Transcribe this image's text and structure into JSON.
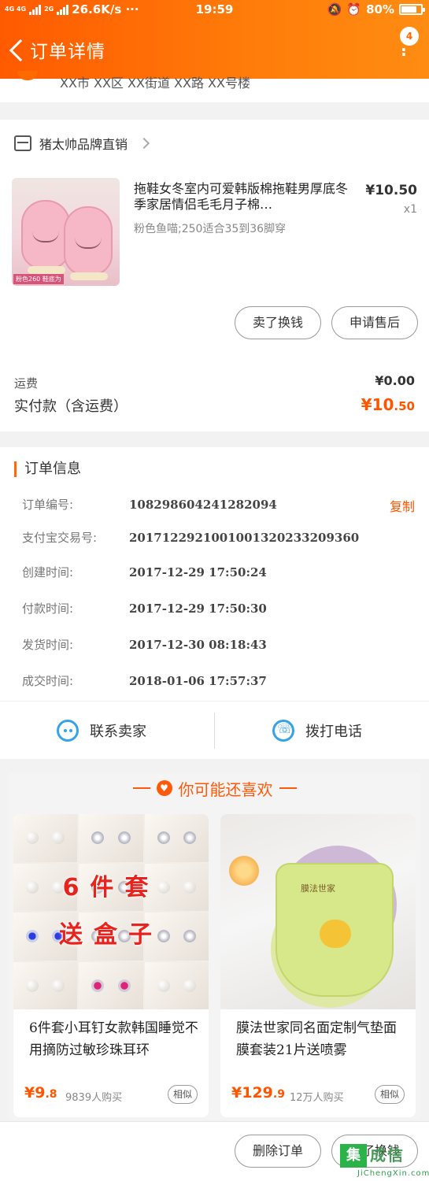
{
  "status_bar": {
    "network": "4G 4G",
    "network2": "2G",
    "speed": "26.6K/s ···",
    "time": "19:59",
    "battery": "80%",
    "battery_level": 0.8
  },
  "header": {
    "title": "订单详情",
    "badge_count": "4"
  },
  "address": {
    "partial_text": "XX市 XX区 XX街道 XX路 XX号楼"
  },
  "shop": {
    "name": "猪太帅品牌直销"
  },
  "product": {
    "title": "拖鞋女冬室内可爱韩版棉拖鞋男厚底冬季家居情侣毛毛月子棉…",
    "sku": "粉色鱼喵;250适合35到36脚穿",
    "price": "¥10.50",
    "qty": "x1",
    "thumb_tag": "粉色260 鞋底为"
  },
  "product_actions": {
    "sell": "卖了换钱",
    "after_sale": "申请售后"
  },
  "fees": {
    "shipping_label": "运费",
    "shipping_value": "¥0.00",
    "paid_label": "实付款（含运费）",
    "paid_int": "¥10",
    "paid_dec": ".50"
  },
  "order_info": {
    "title": "订单信息",
    "copy": "复制",
    "rows": [
      {
        "label": "订单编号:",
        "value": "108298604241282094"
      },
      {
        "label": "支付宝交易号:",
        "value": "2017122921001001320233209360"
      },
      {
        "label": "创建时间:",
        "value": "2017-12-29 17:50:24"
      },
      {
        "label": "付款时间:",
        "value": "2017-12-29 17:50:30"
      },
      {
        "label": "发货时间:",
        "value": "2017-12-30 08:18:43"
      },
      {
        "label": "成交时间:",
        "value": "2018-01-06 17:57:37"
      }
    ]
  },
  "contact": {
    "seller": "联系卖家",
    "call": "拨打电话"
  },
  "recommend": {
    "title": "你可能还喜欢",
    "items": [
      {
        "title": "6件套小耳钉女款韩国睡觉不用摘防过敏珍珠耳环",
        "price_int": "¥9",
        "price_dec": ".8",
        "sales": "9839人购买",
        "similar": "相似",
        "img_text_1": "6件套",
        "img_text_2": "送盒子"
      },
      {
        "title": "膜法世家同名面定制气垫面膜套装21片送喷雾",
        "price_int": "¥129",
        "price_dec": ".9",
        "sales": "12万人购买",
        "similar": "相似",
        "img_logo": "膜法世家"
      }
    ]
  },
  "bottom": {
    "delete": "删除订单",
    "sell": "卖了换钱"
  },
  "watermark": {
    "box": "集",
    "text": "成信",
    "url": "JiChengXin.com"
  },
  "colors": {
    "brand": "#ff6a00",
    "price": "#ff5500",
    "icon_blue": "#36a3e8"
  }
}
